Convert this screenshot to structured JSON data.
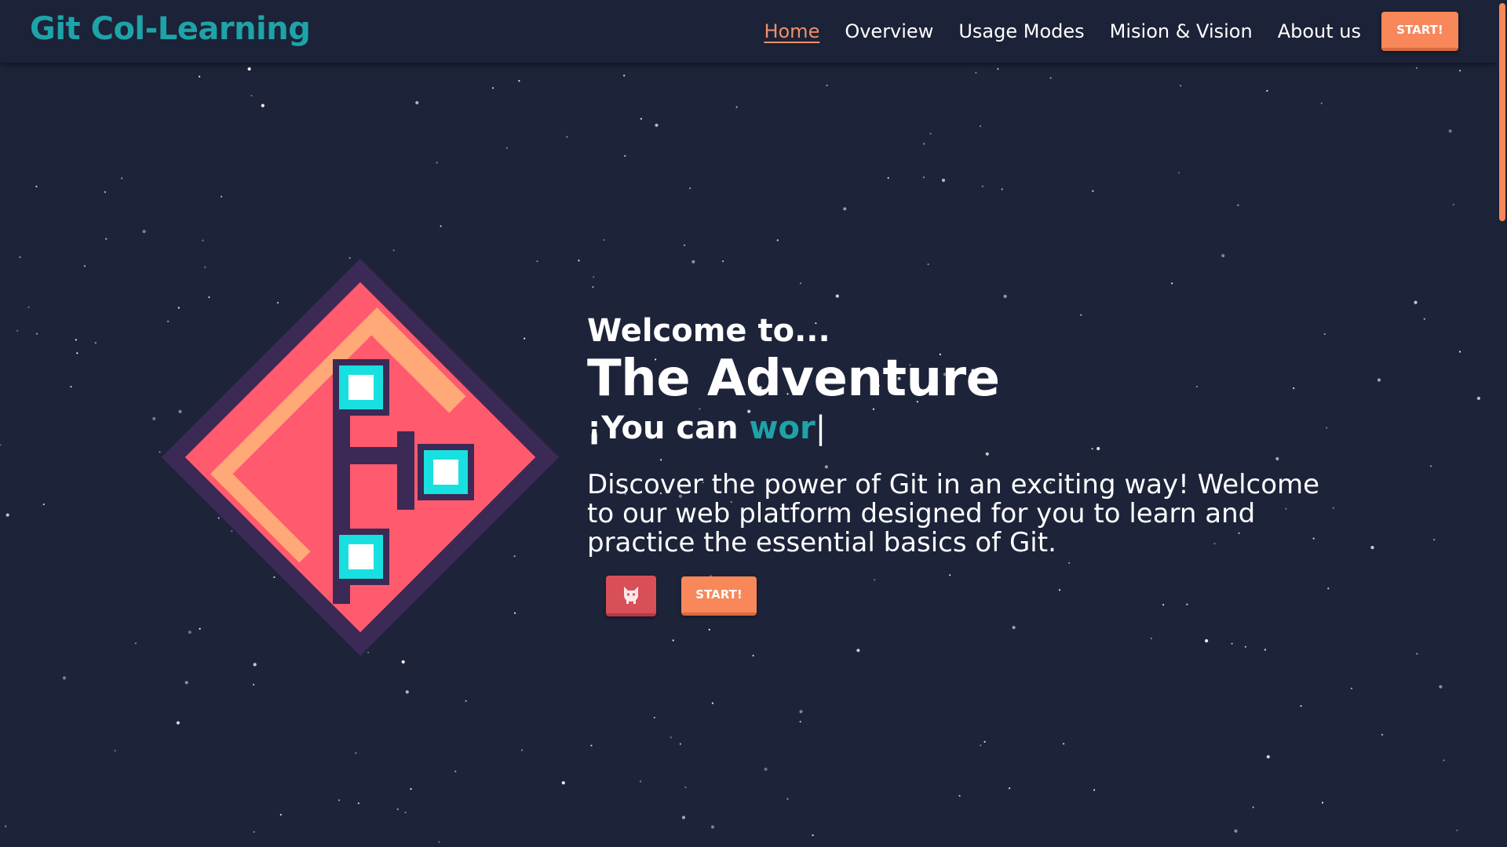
{
  "navbar": {
    "brand": "Git Col-Learning",
    "links": [
      {
        "label": "Home",
        "active": true
      },
      {
        "label": "Overview",
        "active": false
      },
      {
        "label": "Usage Modes",
        "active": false
      },
      {
        "label": "Mision & Vision",
        "active": false
      },
      {
        "label": "About us",
        "active": false
      }
    ],
    "start_label": "START!"
  },
  "hero": {
    "welcome": "Welcome to...",
    "title": "The Adventure",
    "typed_prefix": "¡You can ",
    "typed_word": "wor",
    "cursor": "|",
    "description": "Discover the power of Git in an exciting way! Welcome to our web platform designed for you to learn and practice the essential basics of Git.",
    "github_icon": "github-cat-icon",
    "start_label": "START!"
  },
  "colors": {
    "background": "#1d2339",
    "brand_teal": "#1ea3a8",
    "accent_orange": "#f8875a",
    "active_link": "#f0906a",
    "github_red": "#d94f57",
    "logo_pink": "#ff5a6e",
    "logo_peach": "#ffa878",
    "logo_outline": "#3a2a55",
    "logo_node": "#19e0e0"
  }
}
